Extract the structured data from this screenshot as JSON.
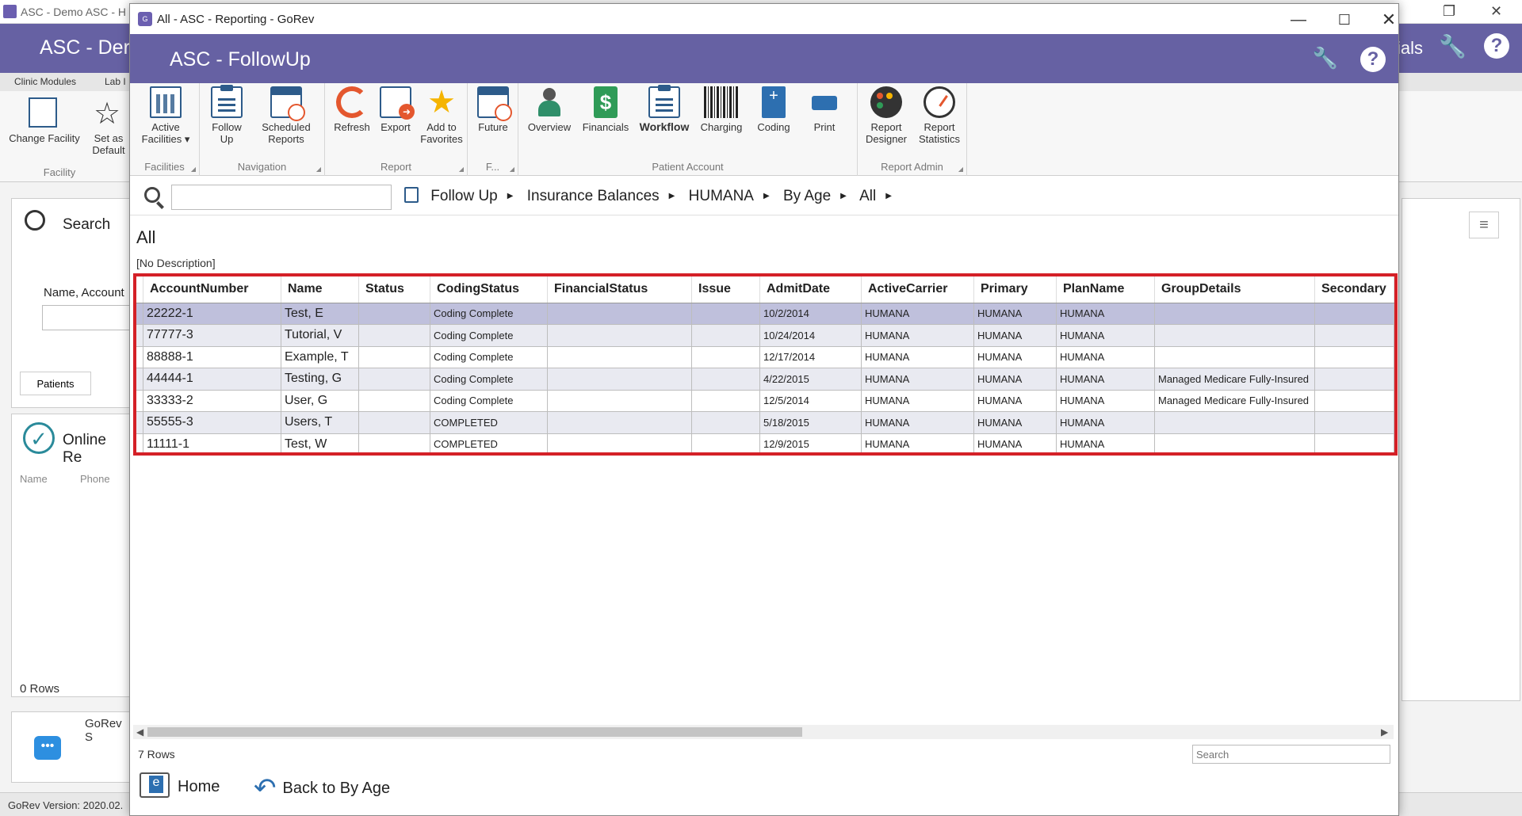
{
  "background_app": {
    "window_title": "ASC - Demo ASC - H",
    "header_title": "ASC - Der",
    "header_right": "ials",
    "tabs": [
      "Clinic Modules",
      "Lab I"
    ],
    "ribbon": {
      "change_facility": "Change Facility",
      "set_as_default": "Set as Default",
      "group": "Facility"
    },
    "search_label": "Search",
    "name_account": "Name, Account",
    "patients_tab": "Patients",
    "online_title": "Online Re",
    "online_cols": [
      "Name",
      "Phone"
    ],
    "rows": "0 Rows",
    "gorev": "GoRev S",
    "version": "GoRev Version: 2020.02."
  },
  "window": {
    "title": "All - ASC - Reporting - GoRev",
    "header": "ASC - FollowUp"
  },
  "ribbon": {
    "groups": [
      {
        "label": "Facilities",
        "buttons": [
          "Active Facilities ▾"
        ]
      },
      {
        "label": "Navigation",
        "buttons": [
          "Follow Up",
          "Scheduled Reports"
        ]
      },
      {
        "label": "Report",
        "buttons": [
          "Refresh",
          "Export",
          "Add to Favorites"
        ]
      },
      {
        "label": "F...",
        "buttons": [
          "Future"
        ]
      },
      {
        "label": "Patient Account",
        "buttons": [
          "Overview",
          "Financials",
          "Workflow",
          "Charging",
          "Coding",
          "Print"
        ]
      },
      {
        "label": "Report Admin",
        "buttons": [
          "Report Designer",
          "Report Statistics"
        ]
      }
    ]
  },
  "breadcrumb": [
    "Follow Up",
    "Insurance Balances",
    "HUMANA",
    "By Age",
    "All"
  ],
  "view": {
    "title": "All",
    "description": "[No Description]"
  },
  "grid": {
    "columns": [
      "AccountNumber",
      "Name",
      "Status",
      "CodingStatus",
      "FinancialStatus",
      "Issue",
      "AdmitDate",
      "ActiveCarrier",
      "Primary",
      "PlanName",
      "GroupDetails",
      "Secondary"
    ],
    "rows": [
      [
        "22222-1",
        "Test, E",
        "",
        "Coding Complete",
        "",
        "",
        "10/2/2014",
        "HUMANA",
        "HUMANA",
        "HUMANA",
        "",
        ""
      ],
      [
        "77777-3",
        "Tutorial, V",
        "",
        "Coding Complete",
        "",
        "",
        "10/24/2014",
        "HUMANA",
        "HUMANA",
        "HUMANA",
        "",
        ""
      ],
      [
        "88888-1",
        "Example, T",
        "",
        "Coding Complete",
        "",
        "",
        "12/17/2014",
        "HUMANA",
        "HUMANA",
        "HUMANA",
        "",
        ""
      ],
      [
        "44444-1",
        "Testing, G",
        "",
        "Coding Complete",
        "",
        "",
        "4/22/2015",
        "HUMANA",
        "HUMANA",
        "HUMANA",
        "Managed Medicare Fully-Insured",
        ""
      ],
      [
        "33333-2",
        "User, G",
        "",
        "Coding Complete",
        "",
        "",
        "12/5/2014",
        "HUMANA",
        "HUMANA",
        "HUMANA",
        "Managed Medicare Fully-Insured",
        ""
      ],
      [
        "55555-3",
        "Users, T",
        "",
        "COMPLETED",
        "",
        "",
        "5/18/2015",
        "HUMANA",
        "HUMANA",
        "HUMANA",
        "",
        ""
      ],
      [
        "11111-1",
        "Test, W",
        "",
        "COMPLETED",
        "",
        "",
        "12/9/2015",
        "HUMANA",
        "HUMANA",
        "HUMANA",
        "",
        ""
      ]
    ]
  },
  "footer": {
    "rows_count": "7 Rows",
    "search_placeholder": "Search",
    "home": "Home",
    "back": "Back to By Age"
  },
  "colors": {
    "header": "#6661a3",
    "highlight_border": "#d42027",
    "selected_row": "#bfc0dc"
  }
}
